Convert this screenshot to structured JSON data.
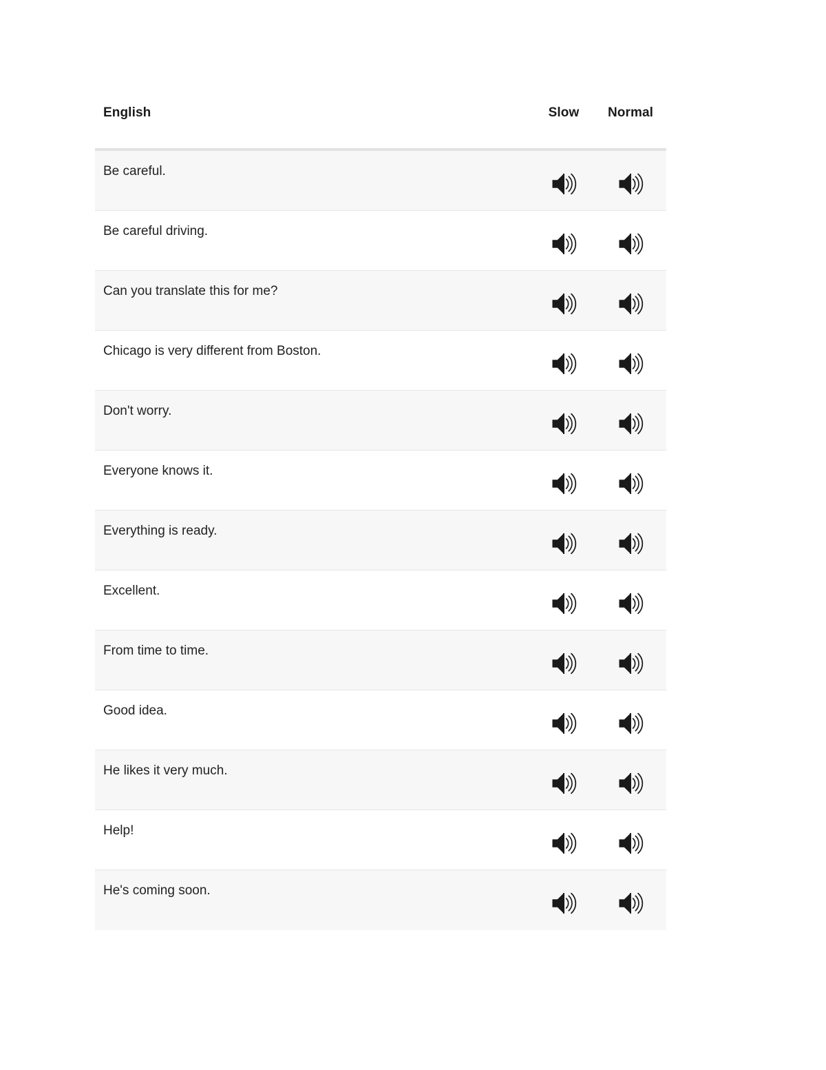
{
  "table": {
    "columns": {
      "english": "English",
      "slow": "Slow",
      "normal": "Normal"
    },
    "icons": {
      "slow": "speaker-icon",
      "normal": "speaker-icon"
    },
    "colors": {
      "row_stripe": "#f7f7f7",
      "row_plain": "#ffffff",
      "row_border": "#e6e6e6",
      "header_rule": "#e2e2e2",
      "text": "#222222",
      "icon": "#1a1a1a"
    },
    "rows": [
      {
        "english": "Be careful."
      },
      {
        "english": "Be careful driving."
      },
      {
        "english": "Can you translate this for me?"
      },
      {
        "english": "Chicago is very different from Boston."
      },
      {
        "english": "Don't worry."
      },
      {
        "english": "Everyone knows it."
      },
      {
        "english": "Everything is ready."
      },
      {
        "english": "Excellent."
      },
      {
        "english": "From time to time."
      },
      {
        "english": "Good idea."
      },
      {
        "english": "He likes it very much."
      },
      {
        "english": "Help!"
      },
      {
        "english": "He's coming soon."
      }
    ]
  }
}
